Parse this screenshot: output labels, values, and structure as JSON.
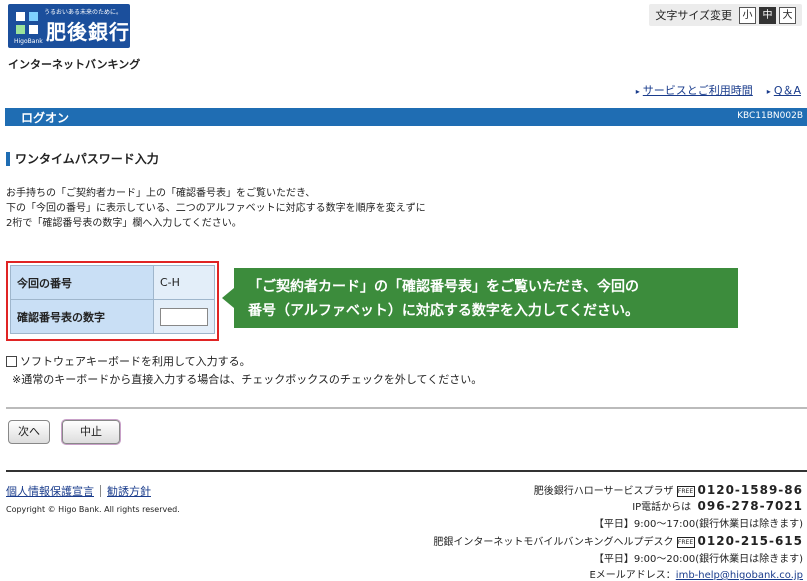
{
  "bank": {
    "tagline": "うるおいある未来のために。",
    "name": "肥後銀行",
    "sub": "HigoBank",
    "service": "インターネットバンキング"
  },
  "fontsize": {
    "label": "文字サイズ変更",
    "small": "小",
    "medium": "中",
    "large": "大"
  },
  "toplinks": {
    "services": "サービスとご利用時間",
    "qa": "Q＆A"
  },
  "titlebar": {
    "title": "ログオン",
    "code": "KBC11BN002B"
  },
  "section": {
    "heading": "ワンタイムパスワード入力"
  },
  "instructions": [
    "お手持ちの「ご契約者カード」上の「確認番号表」をご覧いただき、",
    "下の「今回の番号」に表示している、二つのアルファベットに対応する数字を順序を変えずに",
    "2桁で「確認番号表の数字」欄へ入力してください。"
  ],
  "table": {
    "row1_label": "今回の番号",
    "row1_value": "C-H",
    "row2_label": "確認番号表の数字",
    "row2_value": ""
  },
  "callout": {
    "line1": "「ご契約者カード」の「確認番号表」をご覧いただき、今回の",
    "line2": "番号（アルファベット）に対応する数字を入力してください。"
  },
  "software_keyboard": {
    "label": "ソフトウェアキーボードを利用して入力する。",
    "note": "※通常のキーボードから直接入力する場合は、チェックボックスのチェックを外してください。"
  },
  "buttons": {
    "next": "次へ",
    "cancel": "中止"
  },
  "footer": {
    "privacy": "個人情報保護宣言",
    "solicitation": "勧誘方針",
    "copyright": "Copyright © Higo Bank. All rights reserved.",
    "plaza_name": "肥後銀行ハローサービスプラザ",
    "freedial": "FREE",
    "plaza_number": "0120-1589-86",
    "ip_label": "IP電話からは",
    "ip_number": "096-278-7021",
    "plaza_hours": "【平日】9:00～17:00(銀行休業日は除きます)",
    "helpdesk_name": "肥銀インターネットモバイルバンキングヘルプデスク",
    "helpdesk_number": "0120-215-615",
    "helpdesk_hours": "【平日】9:00～20:00(銀行休業日は除きます)",
    "email_label": "Eメールアドレス：",
    "email": "imb-help@higobank.co.jp"
  },
  "colors": {
    "brand": "#1b4f9c",
    "titlebar": "#1f6db3",
    "callout": "#3c8c3c",
    "highlight": "#e02424"
  }
}
